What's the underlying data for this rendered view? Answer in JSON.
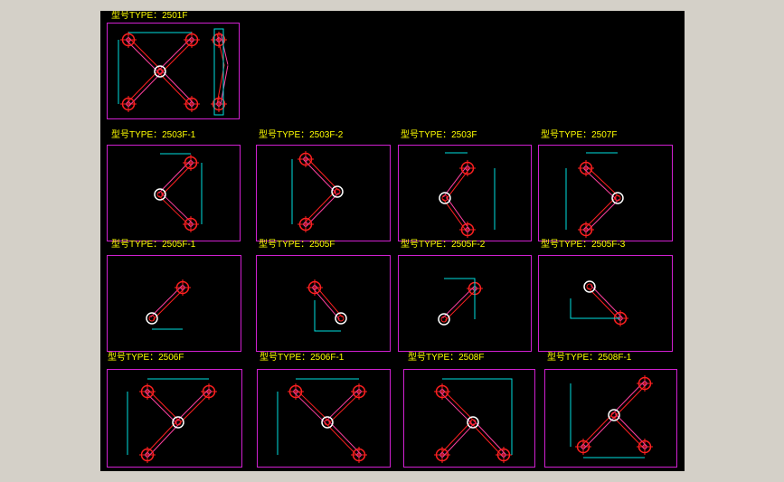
{
  "panels": [
    {
      "id": "p2501F",
      "title": "型号TYPE：2501F",
      "kind": "x"
    },
    {
      "id": "p2503F1",
      "title": "型号TYPE：2503F-1",
      "kind": "k-left"
    },
    {
      "id": "p2503F2",
      "title": "型号TYPE：2503F-2",
      "kind": "k-right"
    },
    {
      "id": "p2503F",
      "title": "型号TYPE：2503F",
      "kind": "c-left"
    },
    {
      "id": "p2507F",
      "title": "型号TYPE：2507F",
      "kind": "c-right"
    },
    {
      "id": "p2505F1",
      "title": "型号TYPE：2505F-1",
      "kind": "l1"
    },
    {
      "id": "p2505F",
      "title": "型号TYPE：2505F",
      "kind": "l2"
    },
    {
      "id": "p2505F2",
      "title": "型号TYPE：2505F-2",
      "kind": "l3"
    },
    {
      "id": "p2505F3",
      "title": "型号TYPE：2505F-3",
      "kind": "l4"
    },
    {
      "id": "p2506F",
      "title": "型号TYPE：2506F",
      "kind": "y1"
    },
    {
      "id": "p2506F1",
      "title": "型号TYPE：2506F-1",
      "kind": "y2"
    },
    {
      "id": "p2508F",
      "title": "型号TYPE：2508F",
      "kind": "w1"
    },
    {
      "id": "p2508F1",
      "title": "型号TYPE：2508F-1",
      "kind": "w2"
    }
  ],
  "colors": {
    "background": "#000000",
    "border": "#d020d0",
    "title": "#ffff00",
    "arm": "#ff2020",
    "arm2": "#ff40a0",
    "dim": "#00e0e0",
    "hub": "#ffffff"
  }
}
